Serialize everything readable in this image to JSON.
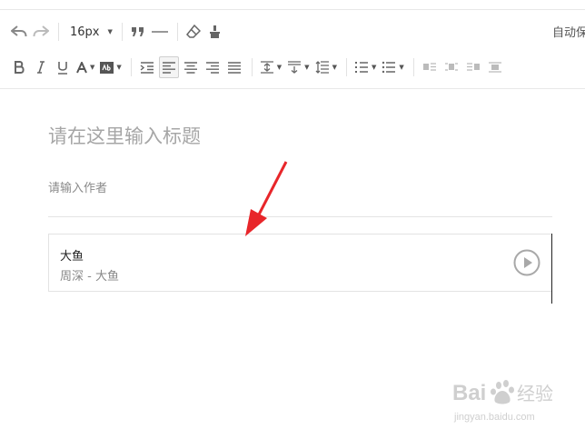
{
  "toolbar": {
    "font_size_value": "16px",
    "autosave_label": "自动保存"
  },
  "editor": {
    "title_placeholder": "请在这里输入标题",
    "author_placeholder": "请输入作者"
  },
  "music_card": {
    "song_title": "大鱼",
    "song_artist": "周深 - 大鱼"
  },
  "watermark": {
    "brand": "Baidu经验",
    "url": "jingyan.baidu.com"
  },
  "colors": {
    "annotation_arrow": "#e8262a",
    "icon_gray": "#666666",
    "placeholder_gray": "#a6a6a6"
  }
}
